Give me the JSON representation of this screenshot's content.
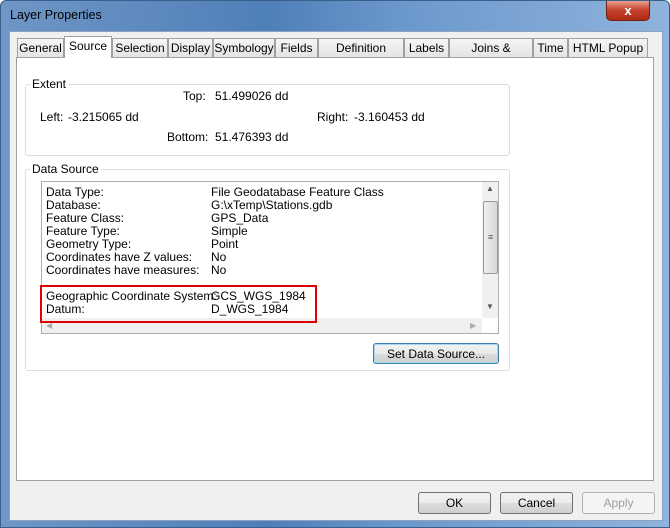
{
  "window": {
    "title": "Layer Properties",
    "close_label": "x"
  },
  "tabs": [
    {
      "label": "General"
    },
    {
      "label": "Source",
      "selected": true
    },
    {
      "label": "Selection"
    },
    {
      "label": "Display"
    },
    {
      "label": "Symbology"
    },
    {
      "label": "Fields"
    },
    {
      "label": "Definition Query"
    },
    {
      "label": "Labels"
    },
    {
      "label": "Joins & Relates"
    },
    {
      "label": "Time"
    },
    {
      "label": "HTML Popup"
    }
  ],
  "extent": {
    "label": "Extent",
    "top": "Top:",
    "top_value": "51.499026 dd",
    "left": "Left:",
    "left_value": "-3.215065 dd",
    "right": "Right:",
    "right_value": "-3.160453 dd",
    "bottom": "Bottom:",
    "bottom_value": "51.476393 dd"
  },
  "data_source": {
    "label": "Data Source",
    "rows": [
      {
        "key": "Data Type:",
        "value": "File Geodatabase Feature Class"
      },
      {
        "key": "Database:",
        "value": "G:\\xTemp\\Stations.gdb"
      },
      {
        "key": "Feature Class:",
        "value": "GPS_Data"
      },
      {
        "key": "Feature Type:",
        "value": "Simple"
      },
      {
        "key": "Geometry Type:",
        "value": "Point"
      },
      {
        "key": "Coordinates have Z values:",
        "value": "No"
      },
      {
        "key": "Coordinates have measures:",
        "value": "No"
      },
      {
        "key": "Geographic Coordinate System:",
        "value": "GCS_WGS_1984"
      },
      {
        "key": "Datum:",
        "value": "D_WGS_1984"
      }
    ],
    "highlight_color": "#e00000",
    "set_button": "Set Data Source..."
  },
  "buttons": {
    "ok": "OK",
    "cancel": "Cancel",
    "apply": "Apply"
  }
}
